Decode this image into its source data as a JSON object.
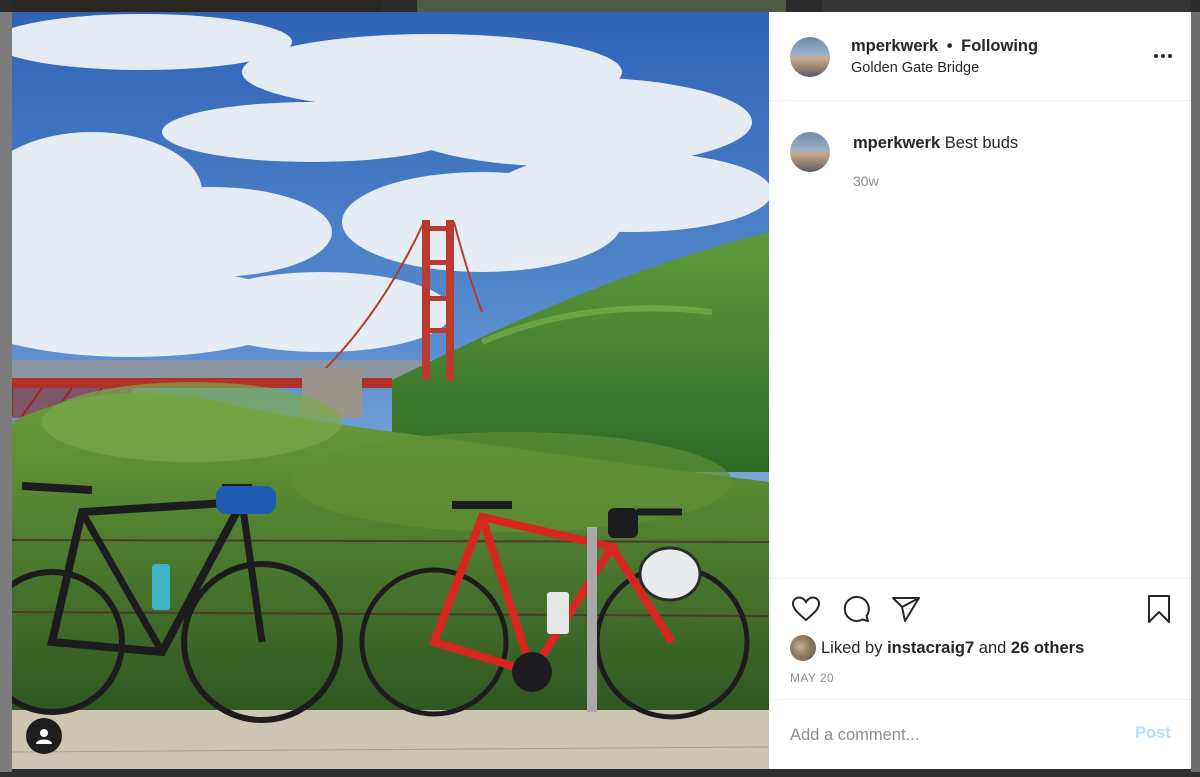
{
  "post": {
    "username": "mperkwerk",
    "separator": "•",
    "follow_status": "Following",
    "location": "Golden Gate Bridge",
    "caption_username": "mperkwerk",
    "caption_text": "Best buds",
    "caption_age": "30w",
    "liked_by_prefix": "Liked by",
    "liked_by_user": "instacraig7",
    "liked_by_and": "and",
    "liked_by_others": "26 others",
    "date": "MAY 20",
    "comment_placeholder": "Add a comment...",
    "post_button": "Post"
  },
  "icons": {
    "more": "more-options-icon",
    "like": "heart-icon",
    "comment": "comment-icon",
    "share": "share-icon",
    "save": "bookmark-icon",
    "profile": "user-icon"
  },
  "colors": {
    "text": "#262626",
    "secondary_text": "#8e8e8e",
    "post_button_disabled": "#b2dffc",
    "divider": "#efefef"
  }
}
